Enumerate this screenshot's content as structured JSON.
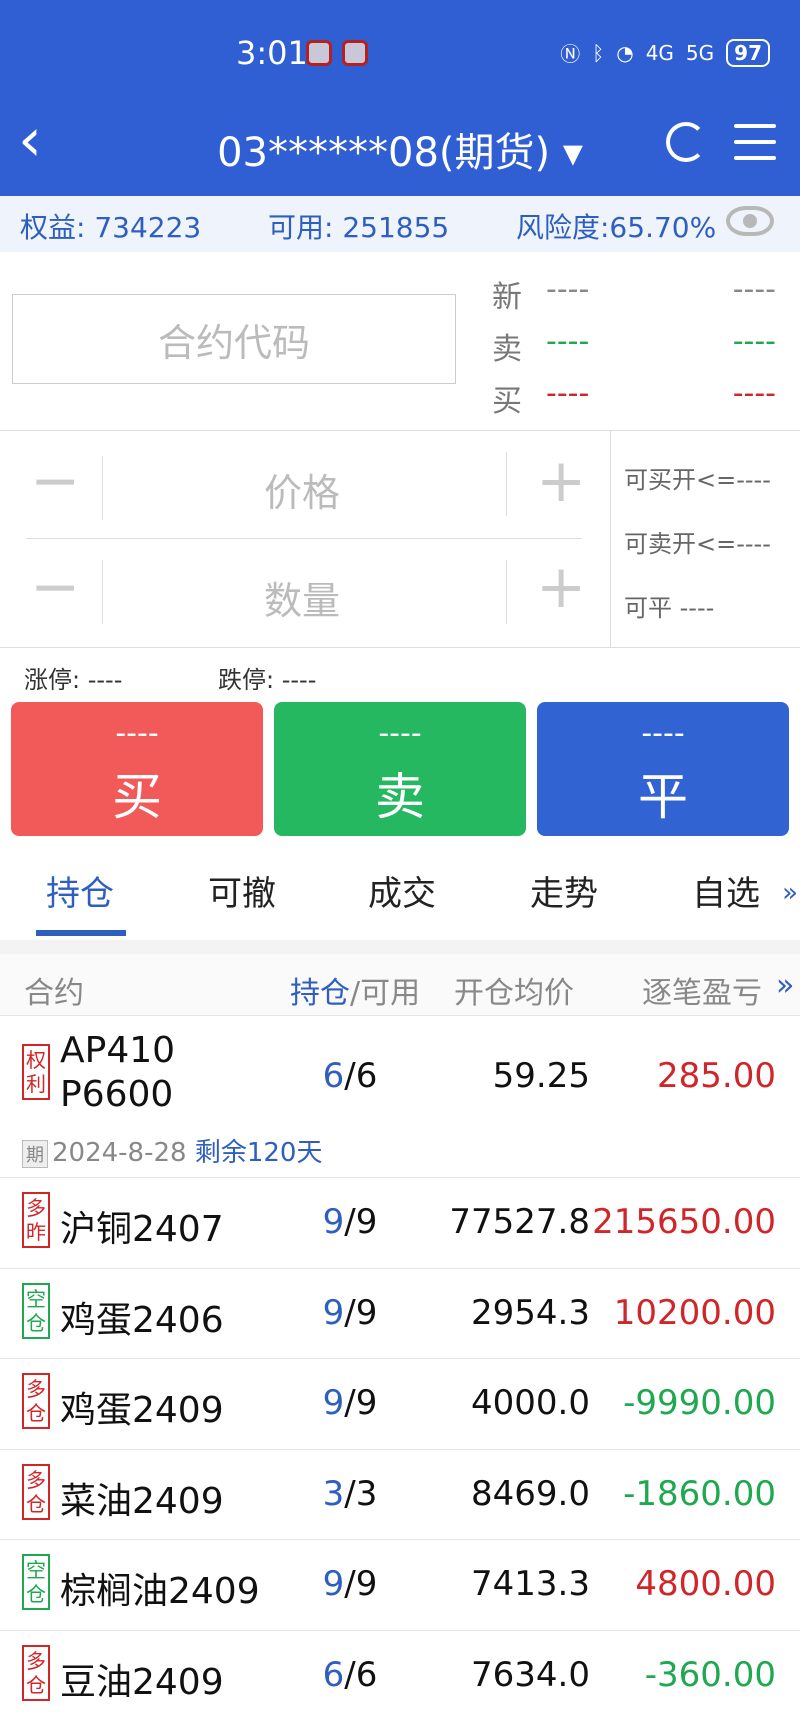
{
  "status": {
    "time": "3:01",
    "battery": "97",
    "signal1": "4G",
    "signal2": "5G"
  },
  "nav": {
    "title": "03******08(期货) ▾"
  },
  "account": {
    "equity": "权益: 734223",
    "available": "可用: 251855",
    "risk": "风险度:65.70%"
  },
  "order": {
    "code_placeholder": "合约代码",
    "quote": [
      {
        "label": "新",
        "v1": "----",
        "v2": "----",
        "color": "#888888"
      },
      {
        "label": "卖",
        "v1": "----",
        "v2": "----",
        "color": "#1fa84f"
      },
      {
        "label": "买",
        "v1": "----",
        "v2": "----",
        "color": "#d0262a"
      }
    ],
    "price_placeholder": "价格",
    "qty_placeholder": "数量",
    "can_buy_open": "可买开<=----",
    "can_sell_open": "可卖开<=----",
    "can_close": "可平  ----",
    "limit_up": "涨停: ----",
    "limit_down": "跌停: ----"
  },
  "buttons": {
    "buy": {
      "dash": "----",
      "label": "买",
      "color": "#f25a5a"
    },
    "sell": {
      "dash": "----",
      "label": "卖",
      "color": "#25b861"
    },
    "close": {
      "dash": "----",
      "label": "平",
      "color": "#3163d3"
    }
  },
  "tabs": [
    "持仓",
    "可撤",
    "成交",
    "走势",
    "自选"
  ],
  "tabs_more": "»",
  "table": {
    "col_contract": "合约",
    "col_pos": "持仓",
    "col_avail": "/可用",
    "col_avg": "开仓均价",
    "col_pl": "逐笔盈亏",
    "col_more": "»",
    "option_row": {
      "tag": [
        "权",
        "利"
      ],
      "name_line1": "AP410",
      "name_line2": "P6600",
      "pos": "6",
      "avail": "6",
      "avg": "59.25",
      "pl": "285.00",
      "expiry_tag": "期",
      "expiry_date": "2024-8-28",
      "expiry_remain": "剩余120天"
    },
    "rows": [
      {
        "tag": [
          "多",
          "昨"
        ],
        "tag_color": "red",
        "name": "沪铜2407",
        "pos": "9",
        "avail": "9",
        "avg": "77527.8",
        "pl": "215650.00",
        "pl_color": "red"
      },
      {
        "tag": [
          "空",
          "仓"
        ],
        "tag_color": "green",
        "name": "鸡蛋2406",
        "pos": "9",
        "avail": "9",
        "avg": "2954.3",
        "pl": "10200.00",
        "pl_color": "red"
      },
      {
        "tag": [
          "多",
          "仓"
        ],
        "tag_color": "red",
        "name": "鸡蛋2409",
        "pos": "9",
        "avail": "9",
        "avg": "4000.0",
        "pl": "-9990.00",
        "pl_color": "green"
      },
      {
        "tag": [
          "多",
          "仓"
        ],
        "tag_color": "red",
        "name": "菜油2409",
        "pos": "3",
        "avail": "3",
        "avg": "8469.0",
        "pl": "-1860.00",
        "pl_color": "green"
      },
      {
        "tag": [
          "空",
          "仓"
        ],
        "tag_color": "green",
        "name": "棕榈油2409",
        "pos": "9",
        "avail": "9",
        "avg": "7413.3",
        "pl": "4800.00",
        "pl_color": "red"
      },
      {
        "tag": [
          "多",
          "仓"
        ],
        "tag_color": "red",
        "name": "豆油2409",
        "pos": "6",
        "avail": "6",
        "avg": "7634.0",
        "pl": "-360.00",
        "pl_color": "green"
      }
    ]
  }
}
